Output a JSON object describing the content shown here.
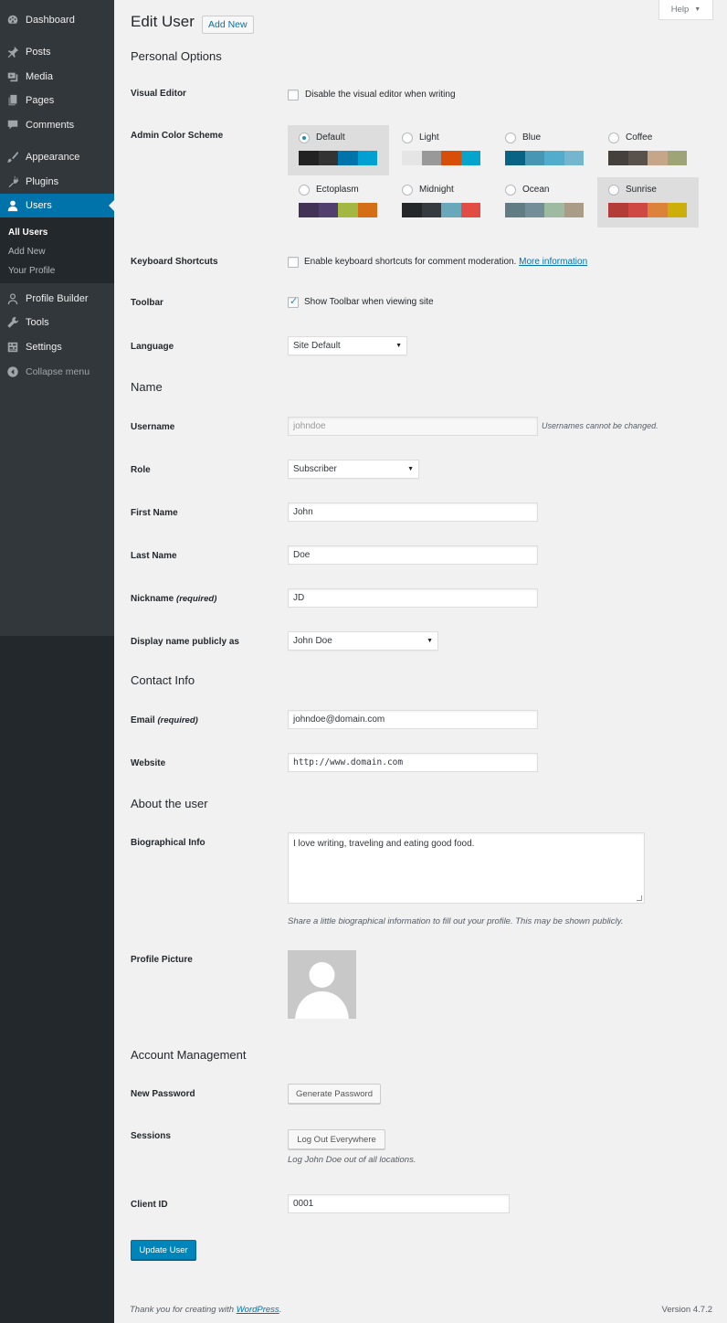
{
  "sidebar": {
    "items": [
      {
        "label": "Dashboard",
        "icon": "dashboard-icon"
      },
      {
        "label": "Posts",
        "icon": "pin-icon"
      },
      {
        "label": "Media",
        "icon": "media-icon"
      },
      {
        "label": "Pages",
        "icon": "pages-icon"
      },
      {
        "label": "Comments",
        "icon": "comments-icon"
      },
      {
        "label": "Appearance",
        "icon": "brush-icon"
      },
      {
        "label": "Plugins",
        "icon": "plug-icon"
      },
      {
        "label": "Users",
        "icon": "user-icon"
      },
      {
        "label": "Profile Builder",
        "icon": "user-outline-icon"
      },
      {
        "label": "Tools",
        "icon": "wrench-icon"
      },
      {
        "label": "Settings",
        "icon": "settings-icon"
      },
      {
        "label": "Collapse menu",
        "icon": "collapse-icon"
      }
    ],
    "users_submenu": [
      "All Users",
      "Add New",
      "Your Profile"
    ]
  },
  "header": {
    "help": "Help",
    "title": "Edit User",
    "add_new": "Add New"
  },
  "personal_options": {
    "heading": "Personal Options",
    "visual_editor": {
      "label": "Visual Editor",
      "text": "Disable the visual editor when writing",
      "checked": false
    },
    "color_scheme": {
      "label": "Admin Color Scheme",
      "selected": "Default",
      "schemes": [
        {
          "name": "Default",
          "colors": [
            "#222222",
            "#333333",
            "#0073aa",
            "#00a0d2"
          ]
        },
        {
          "name": "Light",
          "colors": [
            "#e5e5e5",
            "#999999",
            "#d64e07",
            "#04a4cc"
          ]
        },
        {
          "name": "Blue",
          "colors": [
            "#096484",
            "#4796b3",
            "#52accc",
            "#74b6ce"
          ]
        },
        {
          "name": "Coffee",
          "colors": [
            "#46403c",
            "#59524c",
            "#c7a589",
            "#9ea476"
          ]
        },
        {
          "name": "Ectoplasm",
          "colors": [
            "#413256",
            "#523f6d",
            "#a3b745",
            "#d46f15"
          ]
        },
        {
          "name": "Midnight",
          "colors": [
            "#25282b",
            "#363b3f",
            "#69a8bb",
            "#e14d43"
          ]
        },
        {
          "name": "Ocean",
          "colors": [
            "#627c83",
            "#738e96",
            "#9ebaa0",
            "#aa9d88"
          ]
        },
        {
          "name": "Sunrise",
          "colors": [
            "#b43c38",
            "#cf4944",
            "#dd823b",
            "#ccaf0b"
          ]
        }
      ]
    },
    "keyboard_shortcuts": {
      "label": "Keyboard Shortcuts",
      "text": "Enable keyboard shortcuts for comment moderation.",
      "link": "More information",
      "checked": false
    },
    "toolbar": {
      "label": "Toolbar",
      "text": "Show Toolbar when viewing site",
      "checked": true
    },
    "language": {
      "label": "Language",
      "value": "Site Default"
    }
  },
  "name": {
    "heading": "Name",
    "username": {
      "label": "Username",
      "value": "johndoe",
      "note": "Usernames cannot be changed."
    },
    "role": {
      "label": "Role",
      "value": "Subscriber"
    },
    "first_name": {
      "label": "First Name",
      "value": "John"
    },
    "last_name": {
      "label": "Last Name",
      "value": "Doe"
    },
    "nickname": {
      "label": "Nickname",
      "required": "(required)",
      "value": "JD"
    },
    "display_name": {
      "label": "Display name publicly as",
      "value": "John Doe"
    }
  },
  "contact": {
    "heading": "Contact Info",
    "email": {
      "label": "Email",
      "required": "(required)",
      "value": "johndoe@domain.com"
    },
    "website": {
      "label": "Website",
      "value": "http://www.domain.com"
    }
  },
  "about": {
    "heading": "About the user",
    "bio": {
      "label": "Biographical Info",
      "value": "I love writing, traveling and eating good food.",
      "note": "Share a little biographical information to fill out your profile. This may be shown publicly."
    },
    "picture": {
      "label": "Profile Picture"
    }
  },
  "account": {
    "heading": "Account Management",
    "new_password": {
      "label": "New Password",
      "button": "Generate Password"
    },
    "sessions": {
      "label": "Sessions",
      "button": "Log Out Everywhere",
      "note": "Log John Doe out of all locations."
    },
    "client_id": {
      "label": "Client ID",
      "value": "0001"
    },
    "submit": "Update User"
  },
  "footer": {
    "thanks": "Thank you for creating with",
    "link": "WordPress",
    "period": ".",
    "version": "Version 4.7.2"
  }
}
